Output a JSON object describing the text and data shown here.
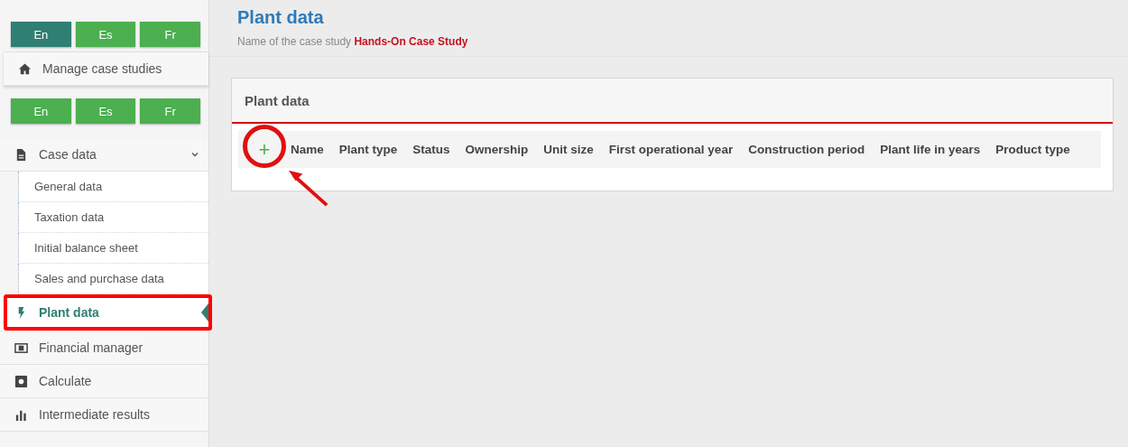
{
  "sidebar": {
    "language_rows": [
      [
        {
          "label": "En",
          "selected": true
        },
        {
          "label": "Es",
          "selected": false
        },
        {
          "label": "Fr",
          "selected": false
        }
      ],
      [
        {
          "label": "En",
          "selected": false
        },
        {
          "label": "Es",
          "selected": false
        },
        {
          "label": "Fr",
          "selected": false
        }
      ]
    ],
    "top_item": {
      "label": "Manage case studies",
      "kind": "home"
    },
    "items": [
      {
        "label": "Case data",
        "kind": "document",
        "selected": false,
        "expanded": true,
        "children": [
          {
            "label": "General data"
          },
          {
            "label": "Taxation data"
          },
          {
            "label": "Initial balance sheet"
          },
          {
            "label": "Sales and purchase data"
          }
        ]
      },
      {
        "label": "Plant data",
        "kind": "bolt",
        "selected": true
      },
      {
        "label": "Financial manager",
        "kind": "money",
        "selected": false
      },
      {
        "label": "Calculate",
        "kind": "calc",
        "selected": false
      },
      {
        "label": "Intermediate results",
        "kind": "chart",
        "selected": false
      }
    ]
  },
  "page": {
    "title": "Plant data",
    "subtitle": "Name of the case study",
    "case_name": "Hands-On Case Study"
  },
  "card": {
    "title": "Plant data",
    "add_button": "+",
    "columns": [
      "Name",
      "Plant type",
      "Status",
      "Ownership",
      "Unit size",
      "First operational year",
      "Construction period",
      "Plant life in years",
      "Product type"
    ]
  }
}
